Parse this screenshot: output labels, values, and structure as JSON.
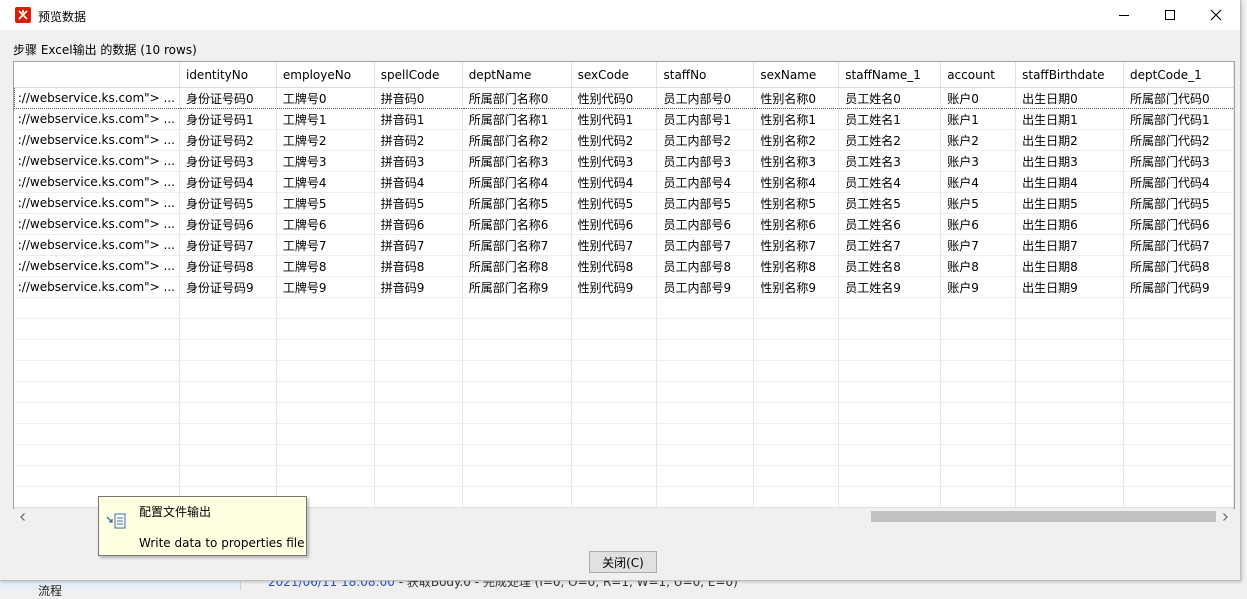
{
  "window": {
    "title": "预览数据"
  },
  "caption": "步骤 Excel输出 的数据  (10 rows)",
  "table": {
    "columns": [
      "",
      "identityNo",
      "employeNo",
      "spellCode",
      "deptName",
      "sexCode",
      "staffNo",
      "sexName",
      "staffName_1",
      "account",
      "staffBirthdate",
      "deptCode_1"
    ],
    "rows": [
      [
        "<.../webservice.ks.com\"> ...",
        "身份证号码0",
        "工牌号0",
        "拼音码0",
        "所属部门名称0",
        "性别代码0",
        "员工内部号0",
        "性别名称0",
        "员工姓名0",
        "账户0",
        "出生日期0",
        "所属部门代码0"
      ],
      [
        "<.../webservice.ks.com\"> ...",
        "身份证号码1",
        "工牌号1",
        "拼音码1",
        "所属部门名称1",
        "性别代码1",
        "员工内部号1",
        "性别名称1",
        "员工姓名1",
        "账户1",
        "出生日期1",
        "所属部门代码1"
      ],
      [
        "<.../webservice.ks.com\"> ...",
        "身份证号码2",
        "工牌号2",
        "拼音码2",
        "所属部门名称2",
        "性别代码2",
        "员工内部号2",
        "性别名称2",
        "员工姓名2",
        "账户2",
        "出生日期2",
        "所属部门代码2"
      ],
      [
        "<.../webservice.ks.com\"> ...",
        "身份证号码3",
        "工牌号3",
        "拼音码3",
        "所属部门名称3",
        "性别代码3",
        "员工内部号3",
        "性别名称3",
        "员工姓名3",
        "账户3",
        "出生日期3",
        "所属部门代码3"
      ],
      [
        "<.../webservice.ks.com\"> ...",
        "身份证号码4",
        "工牌号4",
        "拼音码4",
        "所属部门名称4",
        "性别代码4",
        "员工内部号4",
        "性别名称4",
        "员工姓名4",
        "账户4",
        "出生日期4",
        "所属部门代码4"
      ],
      [
        "<.../webservice.ks.com\"> ...",
        "身份证号码5",
        "工牌号5",
        "拼音码5",
        "所属部门名称5",
        "性别代码5",
        "员工内部号5",
        "性别名称5",
        "员工姓名5",
        "账户5",
        "出生日期5",
        "所属部门代码5"
      ],
      [
        "<.../webservice.ks.com\"> ...",
        "身份证号码6",
        "工牌号6",
        "拼音码6",
        "所属部门名称6",
        "性别代码6",
        "员工内部号6",
        "性别名称6",
        "员工姓名6",
        "账户6",
        "出生日期6",
        "所属部门代码6"
      ],
      [
        "<.../webservice.ks.com\"> ...",
        "身份证号码7",
        "工牌号7",
        "拼音码7",
        "所属部门名称7",
        "性别代码7",
        "员工内部号7",
        "性别名称7",
        "员工姓名7",
        "账户7",
        "出生日期7",
        "所属部门代码7"
      ],
      [
        "<.../webservice.ks.com\"> ...",
        "身份证号码8",
        "工牌号8",
        "拼音码8",
        "所属部门名称8",
        "性别代码8",
        "员工内部号8",
        "性别名称8",
        "员工姓名8",
        "账户8",
        "出生日期8",
        "所属部门代码8"
      ],
      [
        "<.../webservice.ks.com\"> ...",
        "身份证号码9",
        "工牌号9",
        "拼音码9",
        "所属部门名称9",
        "性别代码9",
        "员工内部号9",
        "性别名称9",
        "员工姓名9",
        "账户9",
        "出生日期9",
        "所属部门代码9"
      ]
    ],
    "empty_rows": 10,
    "first_col_visible_text": "://webservice.ks.com\"> ..."
  },
  "tooltip": {
    "title": "配置文件输出",
    "description": "Write data to properties file",
    "icon": "file-output-icon"
  },
  "buttons": {
    "close": "关闭(C)"
  },
  "background": {
    "sidebar_label": "流程",
    "log_timestamp": "2021/06/11 18:08:00",
    "log_text": " - 获取Body.0 - 完成处理 (I=0, O=0, R=1, W=1, U=0, E=0)"
  }
}
